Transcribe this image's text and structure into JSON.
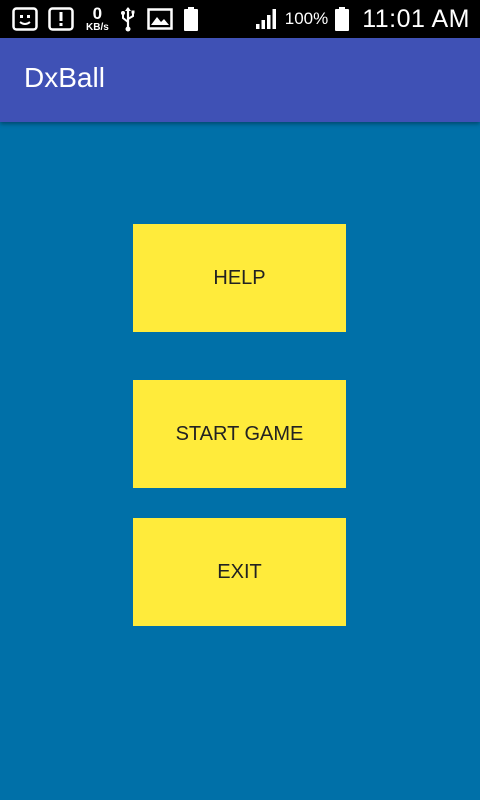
{
  "status_bar": {
    "net_speed_value": "0",
    "net_speed_unit": "KB/s",
    "battery_level_label": "100",
    "battery_percent": "100%",
    "time": "11:01 AM",
    "icons": [
      "notification-face-icon",
      "alert-icon",
      "usb-icon",
      "image-icon",
      "battery-small-icon",
      "signal-icon",
      "battery-icon"
    ]
  },
  "app_bar": {
    "title": "DxBall"
  },
  "menu": {
    "help_label": "HELP",
    "start_label": "START GAME",
    "exit_label": "EXIT"
  },
  "colors": {
    "background": "#0070a8",
    "app_bar": "#3f51b5",
    "button": "#ffeb3b",
    "status_bar": "#000000"
  }
}
